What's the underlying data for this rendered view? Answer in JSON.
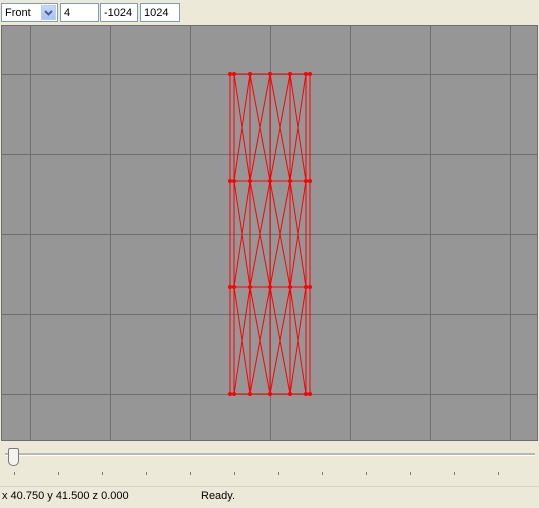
{
  "toolbar": {
    "view_select": "Front",
    "field_1": "4",
    "field_2": "-1024",
    "field_3": "1024"
  },
  "status": {
    "coords": "x 40.750 y 41.500 z 0.000",
    "message": "Ready."
  },
  "colors": {
    "viewport_bg": "#969696",
    "grid": "#6e6e6e",
    "wireframe": "#ff0000"
  },
  "icons": {
    "dropdown": "chevron-down-icon"
  }
}
